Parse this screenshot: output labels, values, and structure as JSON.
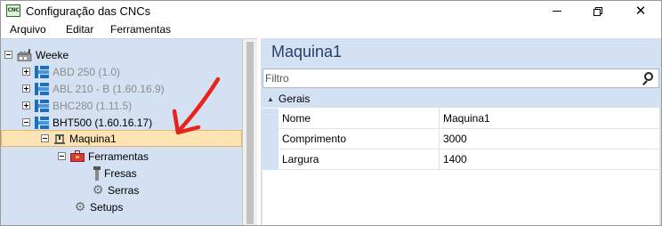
{
  "window": {
    "title": "Configuração das CNCs",
    "app_icon_text": "CNC",
    "controls": [
      "minimize",
      "maximize",
      "close"
    ]
  },
  "menu": {
    "items": [
      "Arquivo",
      "Editar",
      "Ferramentas"
    ]
  },
  "tree": {
    "root": {
      "label": "Weeke",
      "icon": "factory-icon",
      "expanded": true
    },
    "machines": [
      {
        "label": "ABD 250 (1.0)",
        "icon": "cnc-machine-icon",
        "expanded": false,
        "dimmed": true
      },
      {
        "label": "ABL 210 - B (1.60.16.9)",
        "icon": "cnc-machine-icon",
        "expanded": false,
        "dimmed": true
      },
      {
        "label": "BHC280 (1.11.5)",
        "icon": "cnc-machine-icon",
        "expanded": false,
        "dimmed": true
      },
      {
        "label": "BHT500 (1.60.16.17)",
        "icon": "cnc-machine-icon",
        "expanded": true,
        "dimmed": false
      }
    ],
    "selected_node": {
      "label": "Maquina1",
      "icon": "machine-icon",
      "expanded": true
    },
    "children": {
      "tools": {
        "label": "Ferramentas",
        "icon": "toolbox-icon",
        "expanded": true
      },
      "tool_items": [
        {
          "label": "Fresas",
          "icon": "drill-bit-icon"
        },
        {
          "label": "Serras",
          "icon": "saw-blade-icon"
        }
      ],
      "setups": {
        "label": "Setups",
        "icon": "gear-icon"
      }
    }
  },
  "details": {
    "title": "Maquina1",
    "filter": {
      "placeholder": "Filtro",
      "value": ""
    },
    "category": {
      "label": "Gerais",
      "expanded": true
    },
    "properties": [
      {
        "name": "Nome",
        "value": "Maquina1"
      },
      {
        "name": "Comprimento",
        "value": "3000"
      },
      {
        "name": "Largura",
        "value": "1400"
      }
    ]
  },
  "colors": {
    "panel_bg": "#d4e1f3",
    "selection_bg": "#fce4b4",
    "selection_border": "#eab56a",
    "title_text": "#24416d",
    "annotation_arrow": "#e8241a"
  }
}
